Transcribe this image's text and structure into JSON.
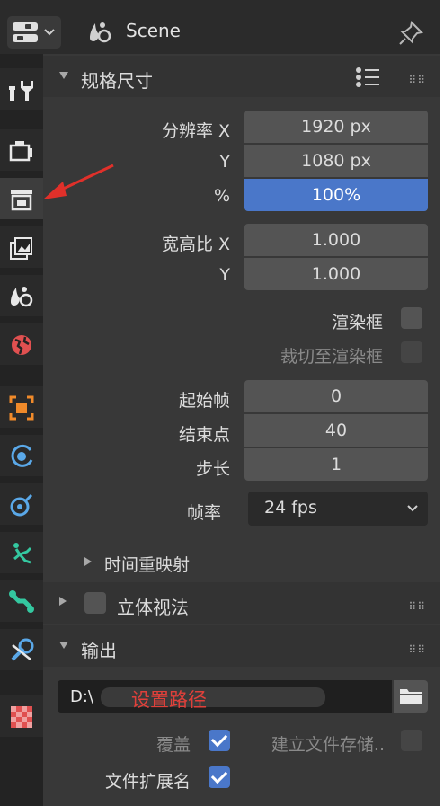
{
  "header": {
    "editor_type_icon": "properties-editor-icon",
    "scene_icon": "scene-icon",
    "scene_label": "Scene",
    "pin_icon": "pin-icon"
  },
  "sidebar": {
    "tabs": [
      {
        "name": "tool",
        "icon": "tool-icon",
        "active": false
      },
      {
        "name": "render",
        "icon": "render-icon",
        "active": false
      },
      {
        "name": "output",
        "icon": "output-icon",
        "active": true
      },
      {
        "name": "view-layer",
        "icon": "view-layer-icon",
        "active": false
      },
      {
        "name": "scene",
        "icon": "scene-icon",
        "active": false
      },
      {
        "name": "world",
        "icon": "world-icon",
        "active": false
      },
      {
        "name": "object",
        "icon": "object-icon",
        "active": false
      },
      {
        "name": "physics",
        "icon": "physics-icon",
        "active": false
      },
      {
        "name": "constraints",
        "icon": "constraints-icon",
        "active": false
      },
      {
        "name": "particles",
        "icon": "particles-icon",
        "active": false
      },
      {
        "name": "data",
        "icon": "data-icon",
        "active": false
      },
      {
        "name": "modifiers",
        "icon": "modifiers-icon",
        "active": false
      },
      {
        "name": "texture",
        "icon": "texture-icon",
        "active": false
      }
    ]
  },
  "format": {
    "title": "规格尺寸",
    "res_x_label": "分辨率 X",
    "res_x": "1920 px",
    "res_y_label": "Y",
    "res_y": "1080 px",
    "pct_label": "%",
    "pct": "100%",
    "aspect_x_label": "宽高比 X",
    "aspect_x": "1.000",
    "aspect_y_label": "Y",
    "aspect_y": "1.000",
    "render_region_label": "渲染框",
    "crop_label": "裁切至渲染框",
    "frame_start_label": "起始帧",
    "frame_start": "0",
    "frame_end_label": "结束点",
    "frame_end": "40",
    "step_label": "步长",
    "step": "1",
    "fps_label": "帧率",
    "fps": "24 fps",
    "time_remap_label": "时间重映射"
  },
  "stereoscopy": {
    "title": "立体视法"
  },
  "output": {
    "title": "输出",
    "path_prefix": "D:\\",
    "path_annotation": "设置路径",
    "overwrite_label": "覆盖",
    "placeholders_label": "建立文件存储..",
    "file_ext_label": "文件扩展名"
  },
  "colors": {
    "accent": "#4a77c9",
    "annotation": "#e0403a"
  }
}
